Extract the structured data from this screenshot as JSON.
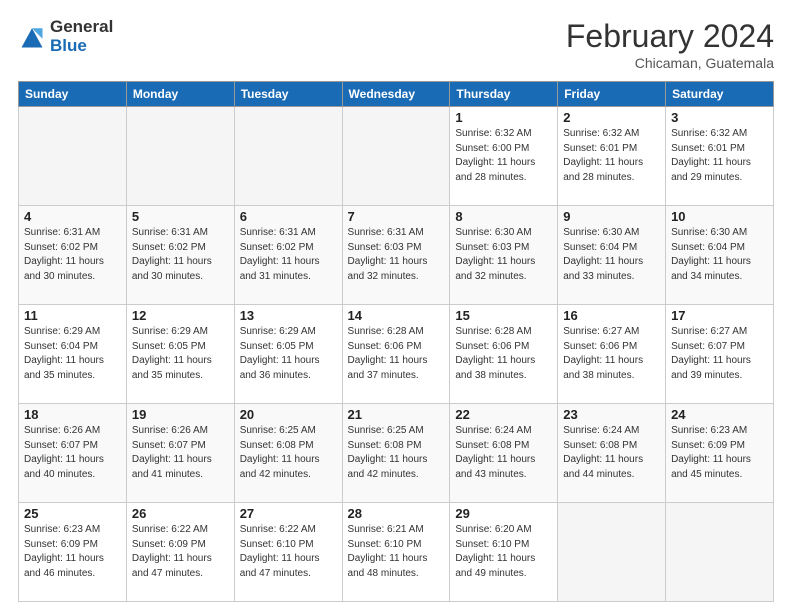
{
  "logo": {
    "general": "General",
    "blue": "Blue"
  },
  "header": {
    "month": "February 2024",
    "location": "Chicaman, Guatemala"
  },
  "days_of_week": [
    "Sunday",
    "Monday",
    "Tuesday",
    "Wednesday",
    "Thursday",
    "Friday",
    "Saturday"
  ],
  "weeks": [
    [
      {
        "day": "",
        "info": ""
      },
      {
        "day": "",
        "info": ""
      },
      {
        "day": "",
        "info": ""
      },
      {
        "day": "",
        "info": ""
      },
      {
        "day": "1",
        "info": "Sunrise: 6:32 AM\nSunset: 6:00 PM\nDaylight: 11 hours and 28 minutes."
      },
      {
        "day": "2",
        "info": "Sunrise: 6:32 AM\nSunset: 6:01 PM\nDaylight: 11 hours and 28 minutes."
      },
      {
        "day": "3",
        "info": "Sunrise: 6:32 AM\nSunset: 6:01 PM\nDaylight: 11 hours and 29 minutes."
      }
    ],
    [
      {
        "day": "4",
        "info": "Sunrise: 6:31 AM\nSunset: 6:02 PM\nDaylight: 11 hours and 30 minutes."
      },
      {
        "day": "5",
        "info": "Sunrise: 6:31 AM\nSunset: 6:02 PM\nDaylight: 11 hours and 30 minutes."
      },
      {
        "day": "6",
        "info": "Sunrise: 6:31 AM\nSunset: 6:02 PM\nDaylight: 11 hours and 31 minutes."
      },
      {
        "day": "7",
        "info": "Sunrise: 6:31 AM\nSunset: 6:03 PM\nDaylight: 11 hours and 32 minutes."
      },
      {
        "day": "8",
        "info": "Sunrise: 6:30 AM\nSunset: 6:03 PM\nDaylight: 11 hours and 32 minutes."
      },
      {
        "day": "9",
        "info": "Sunrise: 6:30 AM\nSunset: 6:04 PM\nDaylight: 11 hours and 33 minutes."
      },
      {
        "day": "10",
        "info": "Sunrise: 6:30 AM\nSunset: 6:04 PM\nDaylight: 11 hours and 34 minutes."
      }
    ],
    [
      {
        "day": "11",
        "info": "Sunrise: 6:29 AM\nSunset: 6:04 PM\nDaylight: 11 hours and 35 minutes."
      },
      {
        "day": "12",
        "info": "Sunrise: 6:29 AM\nSunset: 6:05 PM\nDaylight: 11 hours and 35 minutes."
      },
      {
        "day": "13",
        "info": "Sunrise: 6:29 AM\nSunset: 6:05 PM\nDaylight: 11 hours and 36 minutes."
      },
      {
        "day": "14",
        "info": "Sunrise: 6:28 AM\nSunset: 6:06 PM\nDaylight: 11 hours and 37 minutes."
      },
      {
        "day": "15",
        "info": "Sunrise: 6:28 AM\nSunset: 6:06 PM\nDaylight: 11 hours and 38 minutes."
      },
      {
        "day": "16",
        "info": "Sunrise: 6:27 AM\nSunset: 6:06 PM\nDaylight: 11 hours and 38 minutes."
      },
      {
        "day": "17",
        "info": "Sunrise: 6:27 AM\nSunset: 6:07 PM\nDaylight: 11 hours and 39 minutes."
      }
    ],
    [
      {
        "day": "18",
        "info": "Sunrise: 6:26 AM\nSunset: 6:07 PM\nDaylight: 11 hours and 40 minutes."
      },
      {
        "day": "19",
        "info": "Sunrise: 6:26 AM\nSunset: 6:07 PM\nDaylight: 11 hours and 41 minutes."
      },
      {
        "day": "20",
        "info": "Sunrise: 6:25 AM\nSunset: 6:08 PM\nDaylight: 11 hours and 42 minutes."
      },
      {
        "day": "21",
        "info": "Sunrise: 6:25 AM\nSunset: 6:08 PM\nDaylight: 11 hours and 42 minutes."
      },
      {
        "day": "22",
        "info": "Sunrise: 6:24 AM\nSunset: 6:08 PM\nDaylight: 11 hours and 43 minutes."
      },
      {
        "day": "23",
        "info": "Sunrise: 6:24 AM\nSunset: 6:08 PM\nDaylight: 11 hours and 44 minutes."
      },
      {
        "day": "24",
        "info": "Sunrise: 6:23 AM\nSunset: 6:09 PM\nDaylight: 11 hours and 45 minutes."
      }
    ],
    [
      {
        "day": "25",
        "info": "Sunrise: 6:23 AM\nSunset: 6:09 PM\nDaylight: 11 hours and 46 minutes."
      },
      {
        "day": "26",
        "info": "Sunrise: 6:22 AM\nSunset: 6:09 PM\nDaylight: 11 hours and 47 minutes."
      },
      {
        "day": "27",
        "info": "Sunrise: 6:22 AM\nSunset: 6:10 PM\nDaylight: 11 hours and 47 minutes."
      },
      {
        "day": "28",
        "info": "Sunrise: 6:21 AM\nSunset: 6:10 PM\nDaylight: 11 hours and 48 minutes."
      },
      {
        "day": "29",
        "info": "Sunrise: 6:20 AM\nSunset: 6:10 PM\nDaylight: 11 hours and 49 minutes."
      },
      {
        "day": "",
        "info": ""
      },
      {
        "day": "",
        "info": ""
      }
    ]
  ]
}
